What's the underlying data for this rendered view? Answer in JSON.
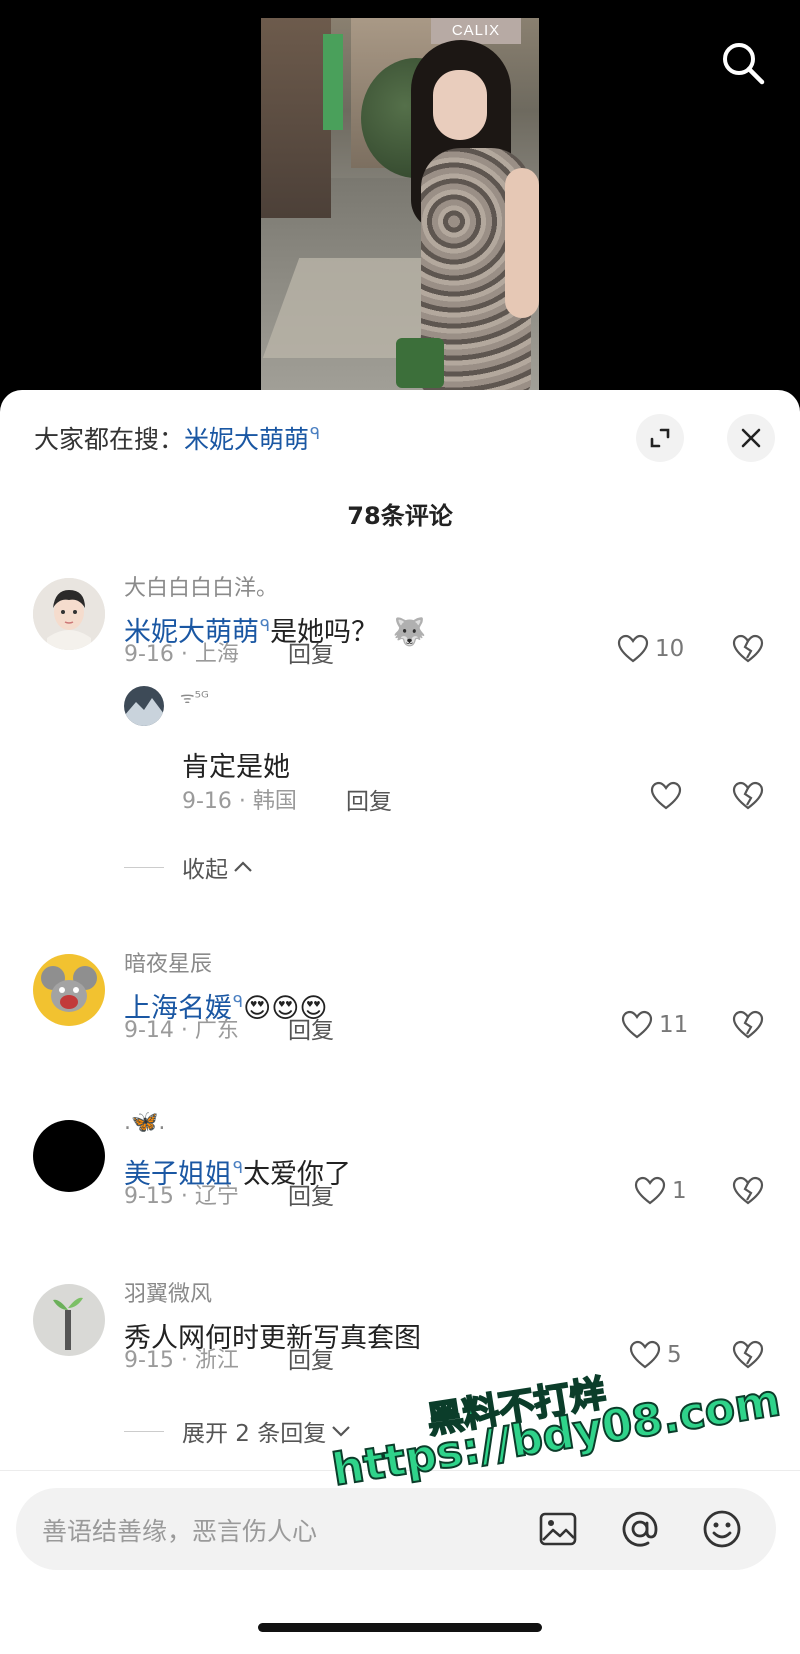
{
  "video": {
    "sign_text": "CALIX"
  },
  "header": {
    "search_prefix": "大家都在搜：",
    "search_keyword": "米妮大萌萌"
  },
  "comments_count": "78条评论",
  "comments": [
    {
      "user": "大白白白白洋。",
      "highlight": "米妮大萌萌",
      "text": "是她吗？",
      "emoji": "🐺",
      "date_location": "9-16 · 上海",
      "reply_label": "回复",
      "likes": "10",
      "replies": [
        {
          "user": "ᯤ⁵ᴳ",
          "text": "肯定是她",
          "date_location": "9-16 · 韩国",
          "reply_label": "回复",
          "likes": ""
        }
      ],
      "fold_label": "收起"
    },
    {
      "user": "暗夜星辰",
      "highlight": "上海名媛",
      "text": "",
      "emoji": "😍😍😍",
      "date_location": "9-14 · 广东",
      "reply_label": "回复",
      "likes": "11"
    },
    {
      "user": ".🦋.",
      "highlight": "美子姐姐",
      "text": "太爱你了",
      "emoji": "",
      "date_location": "9-15 · 辽宁",
      "reply_label": "回复",
      "likes": "1"
    },
    {
      "user": "羽翼微风",
      "highlight": "",
      "text": "秀人网何时更新写真套图",
      "emoji": "",
      "date_location": "9-15 · 浙江",
      "reply_label": "回复",
      "likes": "5",
      "expand_label": "展开 2 条回复"
    }
  ],
  "input": {
    "placeholder": "善语结善缘，恶言伤人心"
  },
  "icons": {
    "search": "search-icon",
    "expand": "expand-icon",
    "close": "close-icon",
    "like": "heart-icon",
    "dislike": "broken-heart-icon",
    "image": "image-icon",
    "mention": "at-icon",
    "emoji": "smiley-icon"
  },
  "colors": {
    "keyword_blue": "#1a57a3",
    "watermark_green": "#2fd38a"
  },
  "watermark": {
    "line1": "黑料不打烊",
    "line2": "https://bdy08.com"
  }
}
